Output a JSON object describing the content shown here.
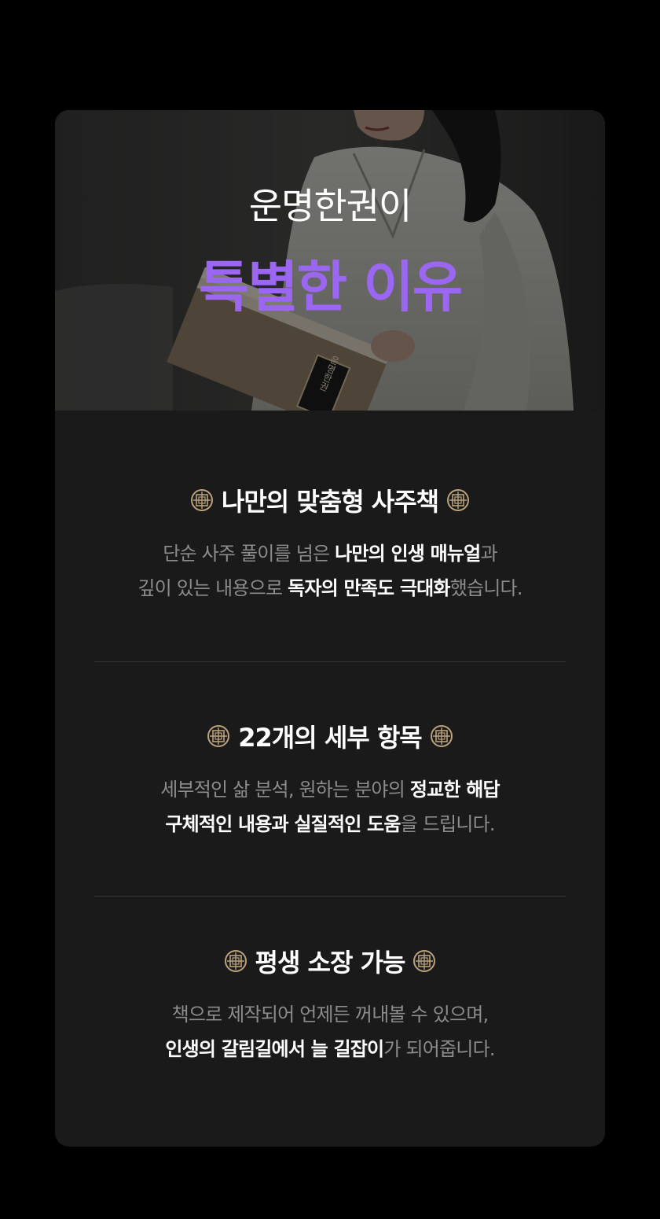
{
  "hero": {
    "title_line1": "운명한권이",
    "title_line2": "특별한 이유",
    "book_spine_text": "운명한권",
    "accent_color": "#9a66f2"
  },
  "sections": [
    {
      "icon": "ornament-icon",
      "title": "나만의 맞춤형 사주책",
      "lines": [
        [
          {
            "text": "단순 사주 풀이를 넘은 ",
            "bold": false
          },
          {
            "text": "나만의 인생 매뉴얼",
            "bold": true
          },
          {
            "text": "과",
            "bold": false
          }
        ],
        [
          {
            "text": "깊이 있는 내용으로 ",
            "bold": false
          },
          {
            "text": "독자의 만족도 극대화",
            "bold": true
          },
          {
            "text": "했습니다.",
            "bold": false
          }
        ]
      ]
    },
    {
      "icon": "ornament-icon",
      "title": "22개의 세부 항목",
      "lines": [
        [
          {
            "text": "세부적인 삶 분석, 원하는 분야의 ",
            "bold": false
          },
          {
            "text": "정교한 해답",
            "bold": true
          }
        ],
        [
          {
            "text": "구체적인 내용과 실질적인 도움",
            "bold": true
          },
          {
            "text": "을 드립니다.",
            "bold": false
          }
        ]
      ]
    },
    {
      "icon": "ornament-icon",
      "title": "평생 소장 가능",
      "lines": [
        [
          {
            "text": "책으로 제작되어 언제든 꺼내볼 수 있으며,",
            "bold": false
          }
        ],
        [
          {
            "text": "인생의 갈림길에서 늘 길잡이",
            "bold": true
          },
          {
            "text": "가 되어줍니다.",
            "bold": false
          }
        ]
      ]
    }
  ]
}
